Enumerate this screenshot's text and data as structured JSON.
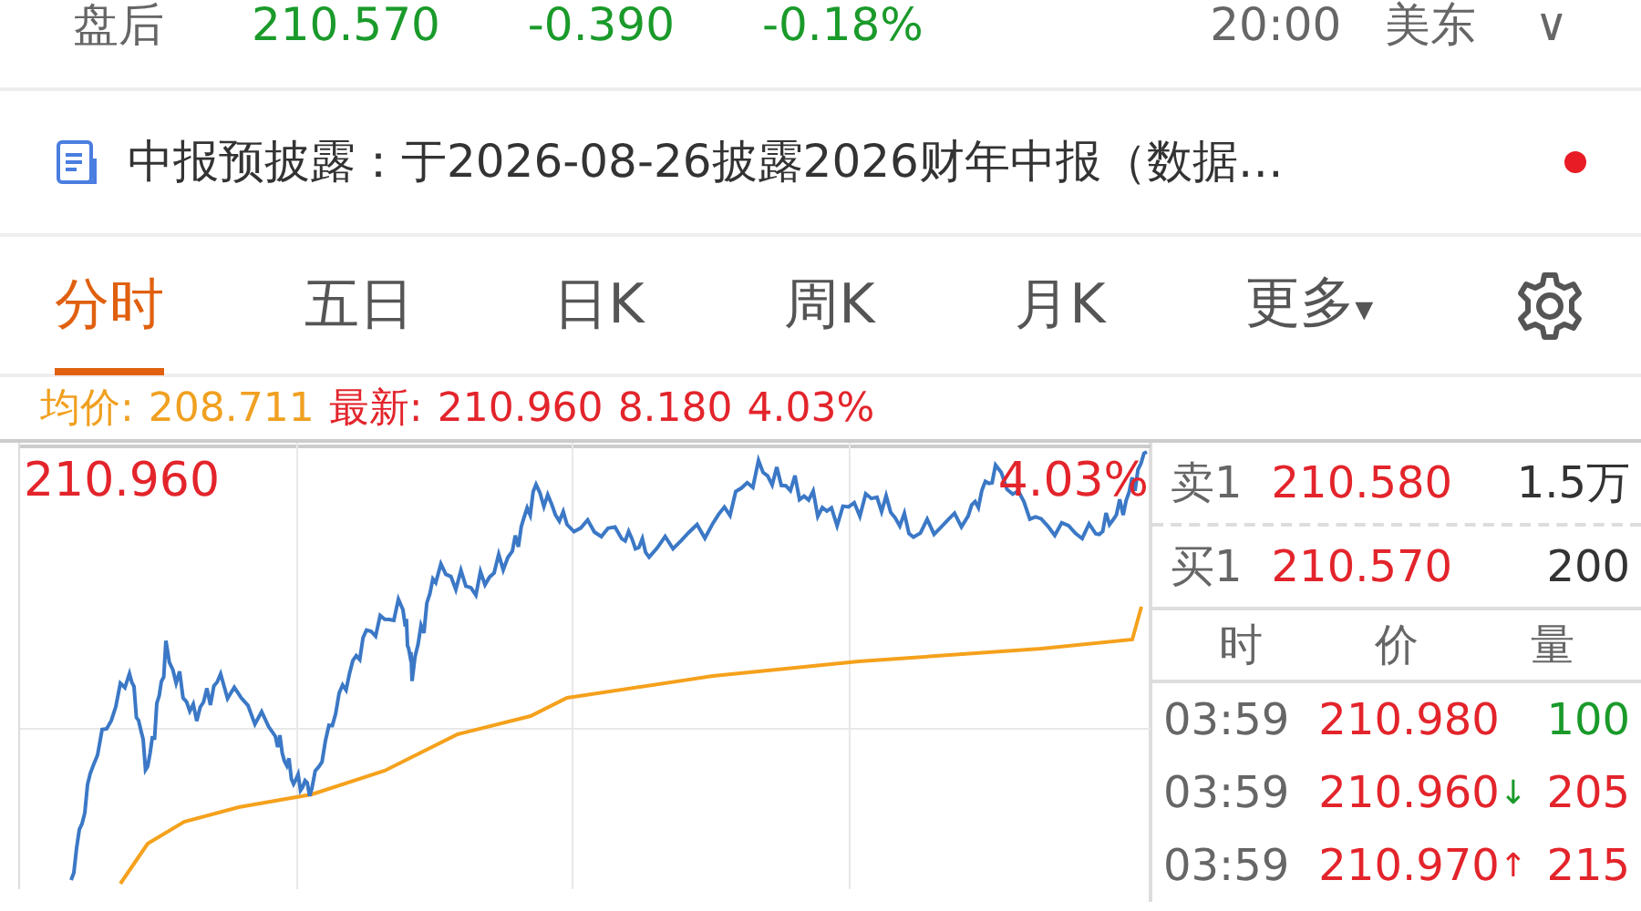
{
  "quote_bar": {
    "label": "盘后",
    "price": "210.570",
    "change": "-0.390",
    "change_pct": "-0.18%",
    "time": "20:00",
    "zone": "美东",
    "caret": "∨"
  },
  "notice": {
    "text": "中报预披露：于2026-08-26披露2026财年中报（数据…",
    "unread": true
  },
  "tabs": [
    {
      "label": "分时",
      "selected": true
    },
    {
      "label": "五日",
      "selected": false
    },
    {
      "label": "日K",
      "selected": false
    },
    {
      "label": "周K",
      "selected": false
    },
    {
      "label": "月K",
      "selected": false
    },
    {
      "label": "更多",
      "selected": false,
      "caret": "▾"
    }
  ],
  "info": {
    "avg_label": "均价:",
    "avg_value": "208.711",
    "latest_label": "最新:",
    "latest_value": "210.960",
    "latest_change": "8.180",
    "latest_pct": "4.03%"
  },
  "chart": {
    "high_label": "210.960",
    "pct_label": "4.03%"
  },
  "order_book": [
    {
      "label": "卖1",
      "price": "210.580",
      "volume": "1.5万"
    },
    {
      "label": "买1",
      "price": "210.570",
      "volume": "200"
    }
  ],
  "trades": {
    "columns": [
      "时",
      "价",
      "量"
    ],
    "rows": [
      {
        "time": "03:59",
        "price": "210.980",
        "volume": "100",
        "kind": "sell"
      },
      {
        "time": "03:59",
        "price": "210.960",
        "arrow": {
          "text": "↓",
          "kind": "down"
        },
        "volume": "205",
        "kind": "buy"
      },
      {
        "time": "03:59",
        "price": "210.970",
        "arrow": {
          "text": "↑",
          "kind": "up"
        },
        "volume": "215",
        "kind": "buy"
      }
    ]
  }
}
